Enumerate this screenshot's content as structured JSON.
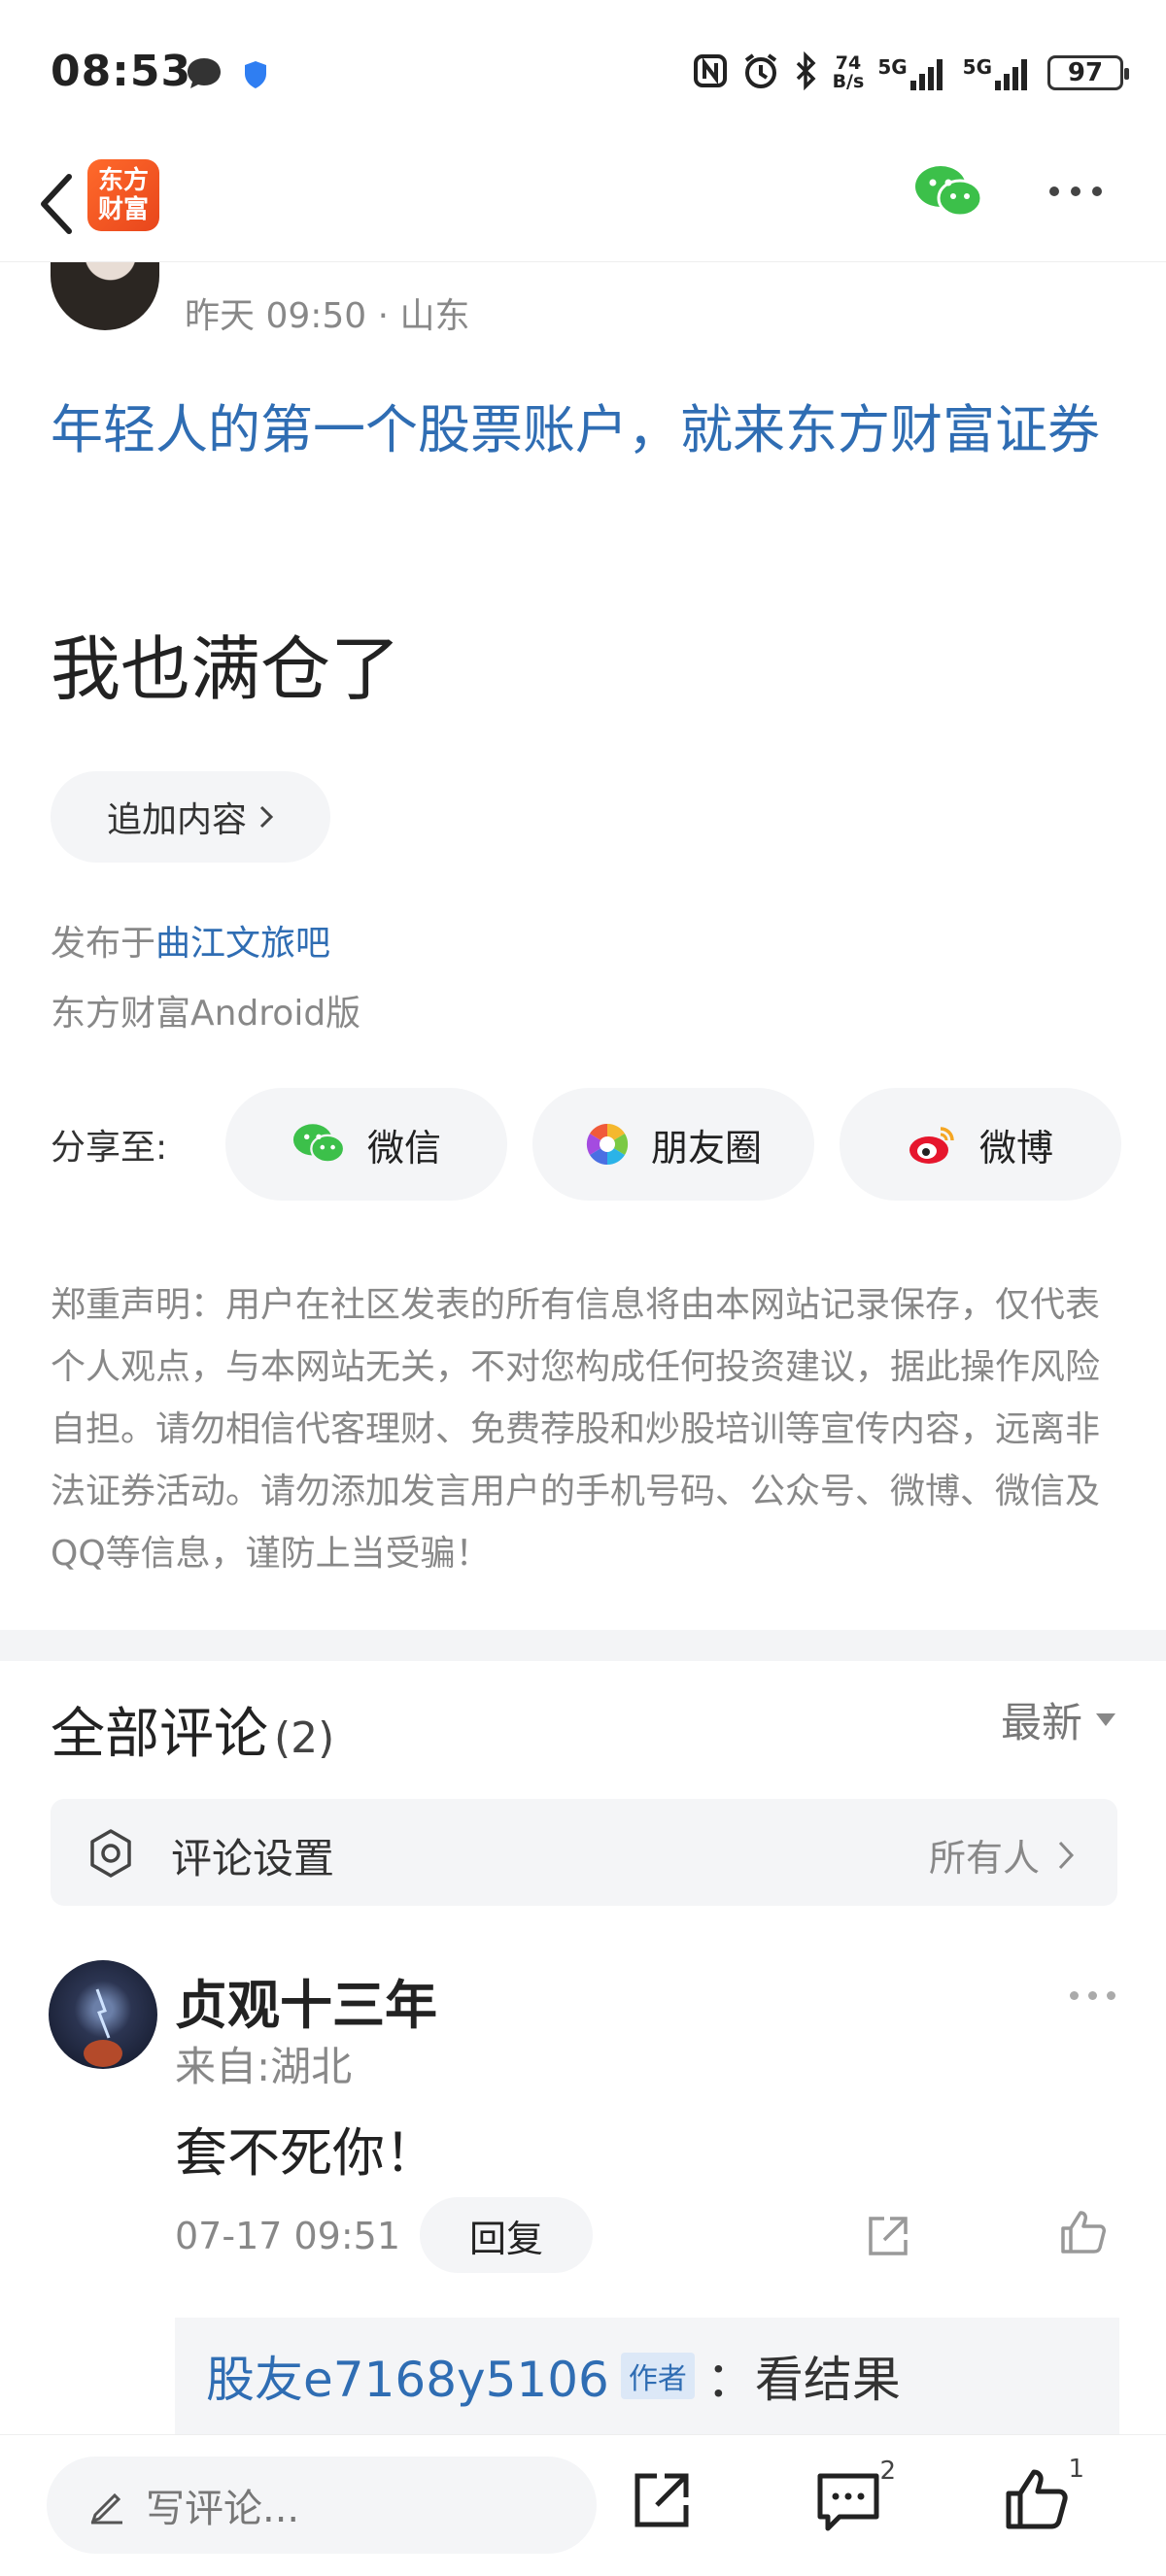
{
  "status_bar": {
    "time": "08:53",
    "speed_top": "74",
    "speed_bottom": "B/s",
    "signal1": "5G",
    "signal2": "5G",
    "battery": "97"
  },
  "nav": {
    "logo_line1": "东方",
    "logo_line2": "财富"
  },
  "post": {
    "meta": "昨天 09:50 · 山东",
    "title": "年轻人的第一个股票账户，就来东方财富证券",
    "body": "我也满仓了",
    "append_label": "追加内容",
    "published_prefix": "发布于",
    "forum": "曲江文旅吧",
    "client": "东方财富Android版"
  },
  "share": {
    "label": "分享至:",
    "wechat": "微信",
    "moments": "朋友圈",
    "weibo": "微博"
  },
  "disclaimer": "郑重声明：用户在社区发表的所有信息将由本网站记录保存，仅代表个人观点，与本网站无关，不对您构成任何投资建议，据此操作风险自担。请勿相信代客理财、免费荐股和炒股培训等宣传内容，远离非法证券活动。请勿添加发言用户的手机号码、公众号、微博、微信及QQ等信息，谨防上当受骗！",
  "comments": {
    "title": "全部评论",
    "count": "(2)",
    "sort": "最新",
    "settings_label": "评论设置",
    "settings_value": "所有人",
    "items": [
      {
        "author": "贞观十三年",
        "from": "来自:湖北",
        "text": "套不死你！",
        "time": "07-17 09:51",
        "reply_label": "回复",
        "sub_reply": {
          "name": "股友e7168y5106",
          "tag": "作者",
          "text": "：看结果"
        }
      }
    ]
  },
  "bottom_bar": {
    "placeholder": "写评论...",
    "comment_count": "2",
    "like_count": "1"
  },
  "colors": {
    "accent_blue": "#2f6db3",
    "brand_orange": "#ff6a2b",
    "wechat_green": "#3cc04a",
    "weibo_red": "#e6162d"
  }
}
